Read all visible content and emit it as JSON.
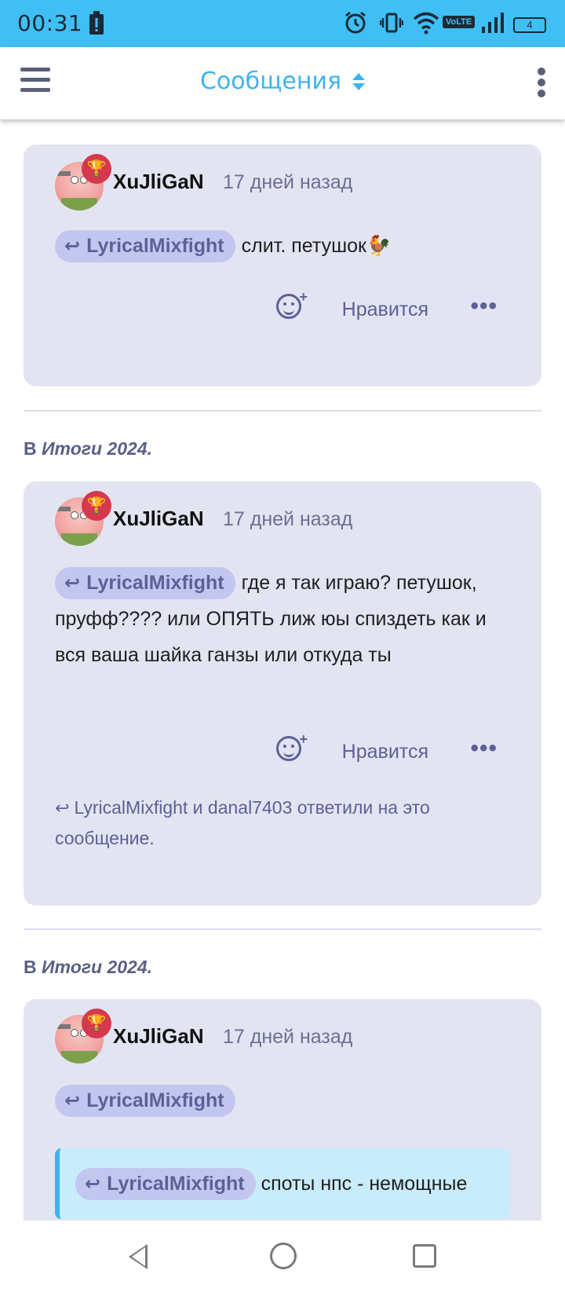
{
  "status_bar": {
    "time": "00:31",
    "battery": "4",
    "network": "VoLTE"
  },
  "app_bar": {
    "title": "Сообщения"
  },
  "posts": [
    {
      "author": "XuJliGaN",
      "time_ago": "17 дней назад",
      "reply_to": "LyricalMixfight",
      "text": "слит. петушок🐓",
      "like_label": "Нравится",
      "more_label": "•••"
    },
    {
      "context_prefix": "В",
      "context_topic": "Итоги 2024.",
      "author": "XuJliGaN",
      "time_ago": "17 дней назад",
      "reply_to": "LyricalMixfight",
      "text": "где я так играю? петушок, пруфф???? или ОПЯТЬ лиж юы спиздеть как и вся ваша шайка ганзы или откуда ты",
      "like_label": "Нравится",
      "more_label": "•••",
      "replied_notice": "LyricalMixfight и danal7403 ответили на это сообщение."
    },
    {
      "context_prefix": "В",
      "context_topic": "Итоги 2024.",
      "author": "XuJliGaN",
      "time_ago": "17 дней назад",
      "reply_to": "LyricalMixfight",
      "quote": {
        "reply_to": "LyricalMixfight",
        "text": "споты нпс - немощные"
      }
    }
  ]
}
